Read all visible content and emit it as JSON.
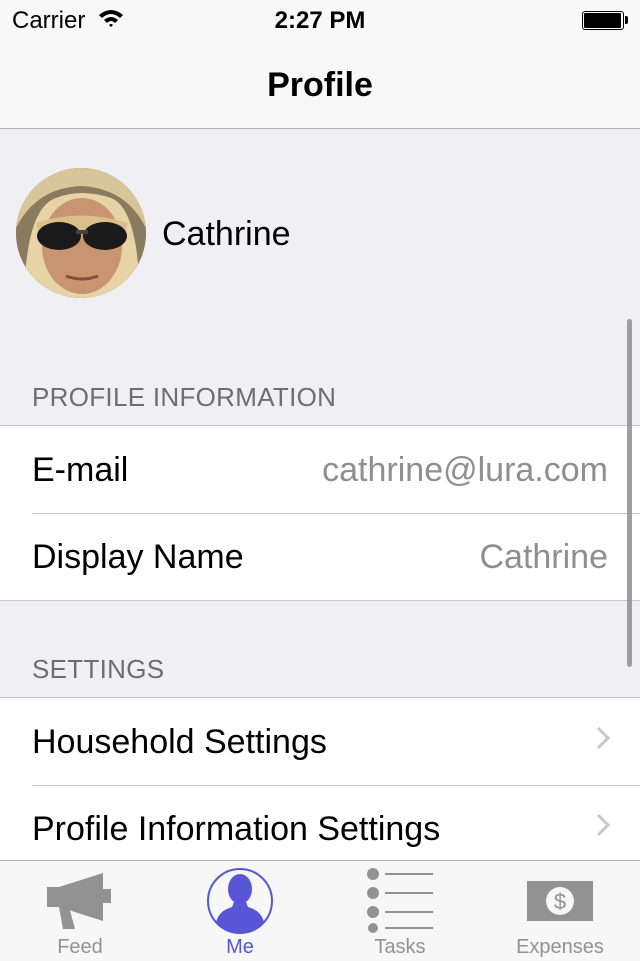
{
  "status_bar": {
    "carrier": "Carrier",
    "time": "2:27 PM"
  },
  "nav": {
    "title": "Profile"
  },
  "profile": {
    "name": "Cathrine"
  },
  "sections": {
    "profile_info": {
      "header": "PROFILE INFORMATION",
      "rows": [
        {
          "label": "E-mail",
          "value": "cathrine@lura.com"
        },
        {
          "label": "Display Name",
          "value": "Cathrine"
        }
      ]
    },
    "settings": {
      "header": "SETTINGS",
      "rows": [
        {
          "label": "Household Settings"
        },
        {
          "label": "Profile Information Settings"
        }
      ]
    }
  },
  "tabs": [
    {
      "label": "Feed",
      "icon": "megaphone-icon",
      "active": false
    },
    {
      "label": "Me",
      "icon": "person-icon",
      "active": true
    },
    {
      "label": "Tasks",
      "icon": "list-icon",
      "active": false
    },
    {
      "label": "Expenses",
      "icon": "money-icon",
      "active": false
    }
  ],
  "colors": {
    "accent": "#5856d6",
    "inactive": "#929292",
    "background": "#efeff4",
    "secondary_text": "#8e8e93"
  }
}
